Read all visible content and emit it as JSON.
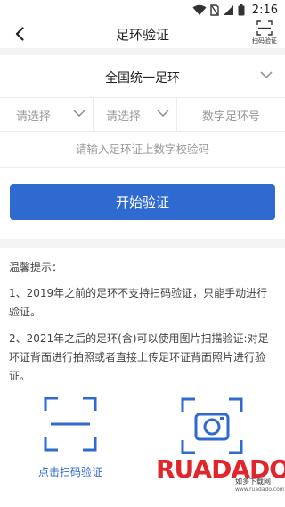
{
  "status_bar": {
    "time": "2:16",
    "icons": [
      "wifi-icon",
      "sim-icon",
      "signal-icon",
      "battery-icon"
    ]
  },
  "nav": {
    "title": "足环验证",
    "scan_label": "扫码验证"
  },
  "form": {
    "region_value": "全国统一足环",
    "select_1": "请选择",
    "select_2": "请选择",
    "ring_number_placeholder": "数字足环号",
    "code_placeholder": "请输入足环证上数字校验码",
    "start_button": "开始验证"
  },
  "tips": {
    "title": "温馨提示：",
    "item_1": "1、2019年之前的足环不支持扫码验证，只能手动进行验证。",
    "item_2": "2、2021年之后的足环(含)可以使用图片扫描验证:对足环证背面进行拍照或者直接上传足环证背面照片进行验证。"
  },
  "actions": {
    "scan_label": "点击扫码验证"
  },
  "watermark": {
    "brand": "RUADADO",
    "cn": "如多下载网",
    "url": "www.ruadado.com"
  },
  "colors": {
    "accent": "#2f6ad0",
    "watermark_red": "#e0262a",
    "watermark_yellow": "#f2c200",
    "watermark_green": "#2aa84a",
    "watermark_blue": "#1f6fd0"
  }
}
